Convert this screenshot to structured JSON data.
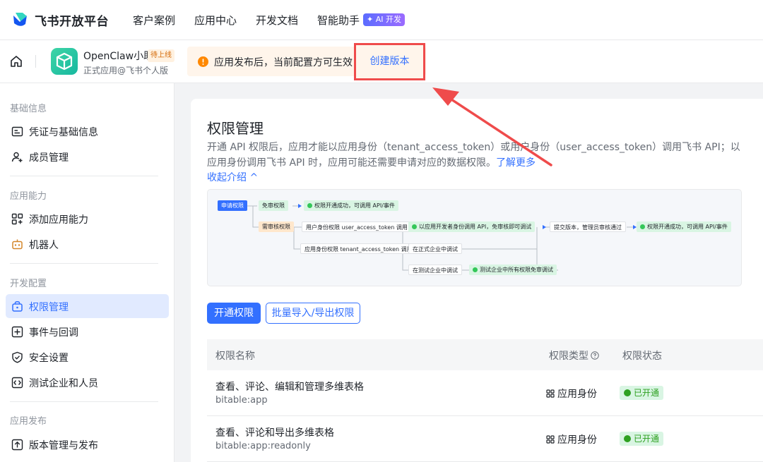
{
  "brand": {
    "name": "飞书开放平台",
    "logo_icon": "feishu-logo-icon"
  },
  "nav": {
    "links": [
      "客户案例",
      "应用中心",
      "开发文档",
      "智能助手"
    ],
    "ai_badge": "✦ AI 开发"
  },
  "app": {
    "name": "OpenClaw小助",
    "status_tag": "待上线",
    "subtitle": "正式应用@飞书个人版",
    "notice": "应用发布后，当前配置方可生效",
    "create_version": "创建版本"
  },
  "sidebar": {
    "groups": [
      "基础信息",
      "应用能力",
      "开发配置",
      "应用发布"
    ],
    "items": [
      {
        "label": "凭证与基础信息",
        "icon": "credential-icon"
      },
      {
        "label": "成员管理",
        "icon": "member-add-icon"
      },
      {
        "label": "添加应用能力",
        "icon": "app-grid-icon"
      },
      {
        "label": "机器人",
        "icon": "robot-icon"
      },
      {
        "label": "权限管理",
        "icon": "lock-icon"
      },
      {
        "label": "事件与回调",
        "icon": "event-icon"
      },
      {
        "label": "安全设置",
        "icon": "shield-icon"
      },
      {
        "label": "测试企业和人员",
        "icon": "code-box-icon"
      },
      {
        "label": "版本管理与发布",
        "icon": "publish-icon"
      }
    ],
    "active_item": "权限管理"
  },
  "main": {
    "title": "权限管理",
    "desc_main": "开通 API 权限后，应用才能以应用身份（tenant_access_token）或用户身份（user_access_token）调用飞书 API；以应用身份调用飞书 API 时，应用可能还需要申请对应的数据权限。",
    "desc_link": "了解更多",
    "collapse_label": "收起介绍 ^",
    "flow": {
      "apply": "申请权限",
      "free": "免审权限",
      "free_result": "权限开通成功，可调用 API/事件",
      "review": "需审核权限",
      "user_identity": "用户身份权限 user_access_token 调用",
      "dev_debug": "以应用开发者身份调用 API，免审核即可调试",
      "submit": "提交版本，管理员审核通过",
      "final_result": "权限开通成功，可调用 API/事件",
      "app_identity": "应用身份权限 tenant_access_token 调用",
      "formal_debug": "在正式企业中调试",
      "test_debug": "在测试企业中调试",
      "test_free": "测试企业中所有权限免审调试"
    },
    "buttons": {
      "enable": "开通权限",
      "batch": "批量导入/导出权限"
    },
    "table": {
      "headers": [
        "权限名称",
        "权限类型",
        "权限状态"
      ],
      "rows": [
        {
          "name": "查看、评论、编辑和管理多维表格",
          "key": "bitable:app",
          "type": "应用身份",
          "status": "已开通"
        },
        {
          "name": "查看、评论和导出多维表格",
          "key": "bitable:app:readonly",
          "type": "应用身份",
          "status": "已开通"
        }
      ]
    }
  },
  "colors": {
    "accent": "#3370ff",
    "annotation": "#ef4b4b",
    "success": "#2ea121",
    "warning": "#d46b08"
  }
}
